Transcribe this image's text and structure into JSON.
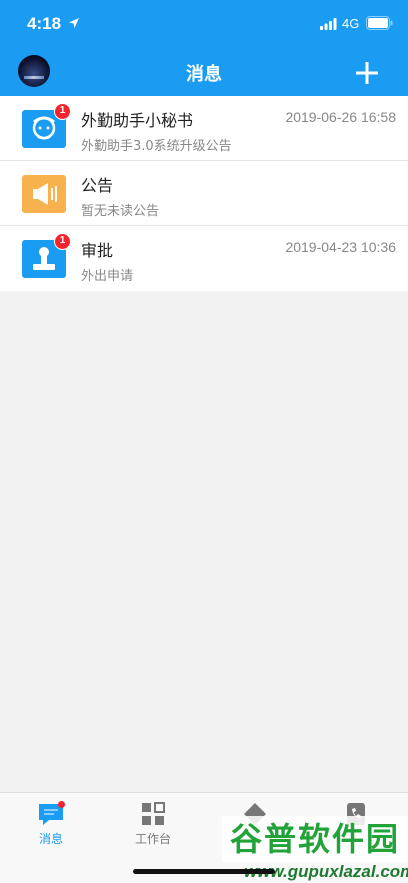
{
  "status": {
    "time": "4:18",
    "network": "4G"
  },
  "header": {
    "title": "消息"
  },
  "messages": [
    {
      "title": "外勤助手小秘书",
      "subtitle": "外勤助手3.0系统升级公告",
      "time": "2019-06-26 16:58",
      "badge": "1",
      "icon": "robot-assistant-icon",
      "color": "#1a9cf2"
    },
    {
      "title": "公告",
      "subtitle": "暂无未读公告",
      "time": "",
      "badge": "",
      "icon": "megaphone-icon",
      "color": "#f8b24d"
    },
    {
      "title": "审批",
      "subtitle": "外出申请",
      "time": "2019-04-23 10:36",
      "badge": "1",
      "icon": "approval-stamp-icon",
      "color": "#1a9cf2"
    }
  ],
  "tabbar": {
    "tabs": [
      {
        "label": "消息",
        "icon": "chat-icon",
        "active": true,
        "has_dot": true
      },
      {
        "label": "工作台",
        "icon": "grid-icon",
        "active": false
      },
      {
        "label": "",
        "icon": "diamond-nav-icon",
        "active": false
      },
      {
        "label": "",
        "icon": "phone-icon",
        "active": false
      }
    ]
  },
  "watermark": {
    "text": "谷普软件园",
    "url": "www.gupuxlazal.com"
  },
  "colors": {
    "primary": "#1a9cf2",
    "badge": "#f4232d",
    "announce": "#f8b24d",
    "watermark": "#21a33a"
  }
}
